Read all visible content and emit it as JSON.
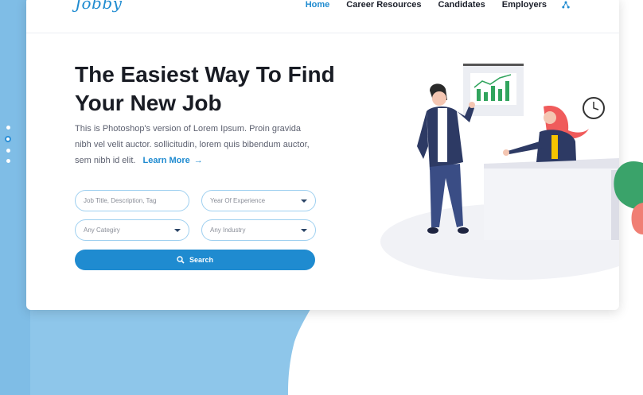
{
  "brand": {
    "logo": "Jobby"
  },
  "nav": {
    "items": [
      {
        "label": "Home",
        "active": true
      },
      {
        "label": "Career Resources",
        "active": false
      },
      {
        "label": "Candidates",
        "active": false
      },
      {
        "label": "Employers",
        "active": false
      }
    ],
    "extra_icon": "network-icon"
  },
  "hero": {
    "headline_line1": "The Easiest Way To Find",
    "headline_line2": "Your New Job",
    "description": "This is Photoshop's version of Lorem Ipsum. Proin gravida nibh vel velit auctor. sollicitudin, lorem quis bibendum auctor, sem nibh id elit.",
    "learn_more": "Learn More",
    "learn_more_icon": "arrow-right-icon"
  },
  "search_form": {
    "keyword_placeholder": "Job Title, Description, Tag",
    "experience_select": "Year Of Experience",
    "category_select": "Any Categiry",
    "industry_select": "Any Industry",
    "search_button": "Search"
  },
  "slider": {
    "dots": 4,
    "active_index": 1
  },
  "colors": {
    "accent": "#1f8bd0",
    "blob": "#8ec6ea",
    "heading": "#191c24"
  }
}
